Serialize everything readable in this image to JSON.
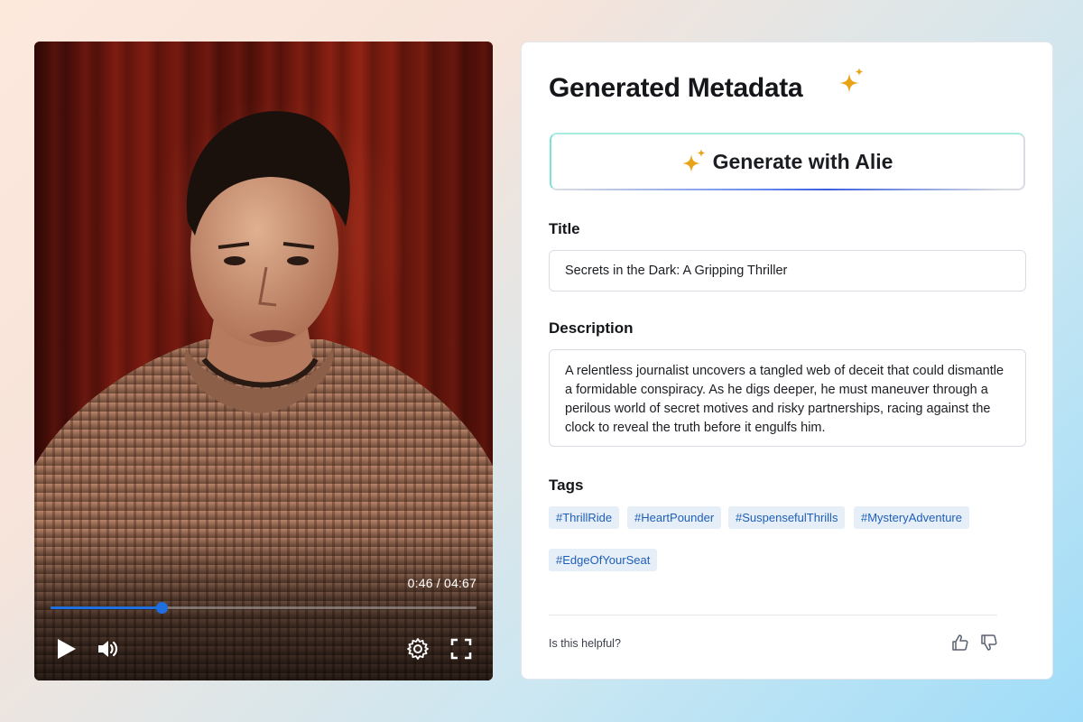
{
  "player": {
    "current_time": "0:46",
    "duration": "04:67",
    "time_display": "0:46 / 04:67",
    "progress_fraction": 0.26,
    "icons": [
      "play-icon",
      "volume-icon",
      "settings-gear-icon",
      "fullscreen-icon"
    ]
  },
  "metadata": {
    "heading": "Generated Metadata",
    "generate_button": "Generate with Alie",
    "title_label": "Title",
    "title_value": "Secrets in the Dark: A Gripping Thriller",
    "description_label": "Description",
    "description_value": "A relentless journalist uncovers a tangled web of deceit that could dismantle a formidable conspiracy. As he digs deeper, he must maneuver through a perilous world of secret motives and risky partnerships, racing against the clock to reveal the truth before it engulfs him.",
    "tags_label": "Tags",
    "tags": [
      "#ThrillRide",
      "#HeartPounder",
      "#SuspensefulThrills",
      "#MysteryAdventure",
      "#EdgeOfYourSeat"
    ],
    "feedback_prompt": "Is this helpful?"
  },
  "colors": {
    "accent_blue": "#1f6fe0",
    "tag_bg": "#e6eef8",
    "tag_text": "#1f5fb8",
    "sparkle": "#e8a317"
  }
}
